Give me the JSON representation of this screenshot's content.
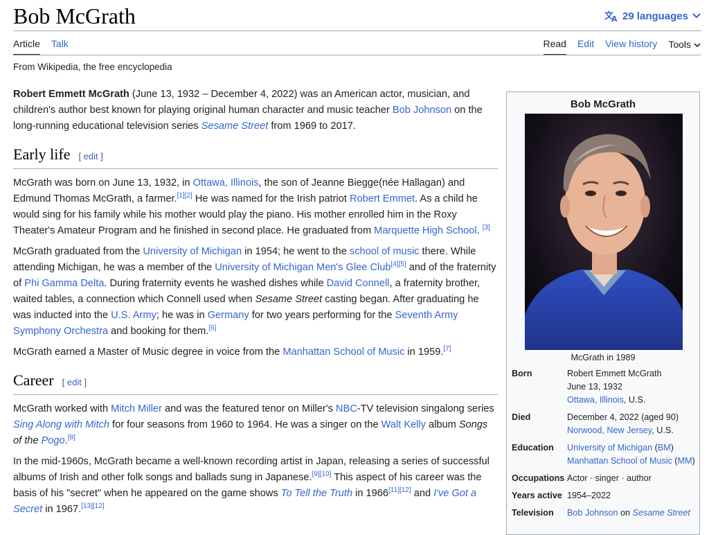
{
  "page": {
    "title": "Bob McGrath",
    "languages": "29 languages",
    "tabs_left": [
      "Article",
      "Talk"
    ],
    "tabs_right": [
      "Read",
      "Edit",
      "View history",
      "Tools"
    ],
    "tagline": "From Wikipedia, the free encyclopedia"
  },
  "intro": {
    "bold_name": "Robert Emmett McGrath",
    "t1": " (June 13, 1932 – December 4, 2022) was an American actor, musician, and children's author best known for playing original human character and music teacher ",
    "l1": "Bob Johnson",
    "t2": " on the long-running educational television series ",
    "l2": "Sesame Street",
    "t3": " from 1969 to 2017."
  },
  "sections": {
    "early_life": "Early life",
    "career": "Career",
    "edit_label": "edit"
  },
  "early": {
    "p1": {
      "t1": "McGrath was born on June 13, 1932, in ",
      "l1": "Ottawa, Illinois",
      "t2": ", the son of Jeanne Biegge(née Hallagan) and Edmund Thomas McGrath, a farmer.",
      "r1": "[1]",
      "r2": "[2]",
      "t3": " He was named for the Irish patriot ",
      "l2": "Robert Emmet",
      "t4": ". As a child he would sing for his family while his mother would play the piano. His mother enrolled him in the Roxy Theater's Amateur Program and he finished in second place. He graduated from ",
      "l3": "Marquette High School",
      "t5": ". ",
      "r3": "[3]"
    },
    "p2": {
      "t1": "McGrath graduated from the ",
      "l1": "University of Michigan",
      "t2": " in 1954; he went to the ",
      "l2": "school of music",
      "t3": " there. While attending Michigan, he was a member of the ",
      "l3": "University of Michigan Men's Glee Club",
      "r4": "[4]",
      "r5": "[5]",
      "t4": " and of the fraternity of ",
      "l4": "Phi Gamma Delta",
      "t5": ". During fraternity events he washed dishes while ",
      "l5": "David Connell",
      "t6": ", a fraternity brother, waited tables, a connection which Connell used when ",
      "i1": "Sesame Street",
      "t7": " casting began. After graduating he was inducted into the ",
      "l6": "U.S. Army",
      "t8": "; he was in ",
      "l7": "Germany",
      "t9": " for two years performing for the ",
      "l8": "Seventh Army Symphony Orchestra",
      "t10": " and booking for them.",
      "r6": "[6]"
    },
    "p3": {
      "t1": "McGrath earned a Master of Music degree in voice from the ",
      "l1": "Manhattan School of Music",
      "t2": " in 1959.",
      "r7": "[7]"
    }
  },
  "career": {
    "p1": {
      "t1": "McGrath worked with ",
      "l1": "Mitch Miller",
      "t2": " and was the featured tenor on Miller's ",
      "l2": "NBC",
      "t3": "-TV television singalong series ",
      "l3": "Sing Along with Mitch",
      "t4": " for four seasons from 1960 to 1964. He was a singer on the ",
      "l4": "Walt Kelly",
      "t5": " album ",
      "i1": "Songs of the ",
      "l5": "Pogo",
      "t6": ".",
      "r8": "[8]"
    },
    "p2": {
      "t1": "In the mid-1960s, McGrath became a well-known recording artist in Japan, releasing a series of successful albums of Irish and other folk songs and ballads sung in Japanese.",
      "r9": "[9]",
      "r10": "[10]",
      "t2": " This aspect of his career was the basis of his \"secret\" when he appeared on the game shows ",
      "l1": "To Tell the Truth",
      "t3": " in 1966",
      "r11": "[11]",
      "r12": "[12]",
      "t4": " and ",
      "l2": "I've Got a Secret",
      "t5": " in 1967.",
      "r13": "[13]",
      "r14": "[12]"
    }
  },
  "infobox": {
    "title": "Bob McGrath",
    "caption": "McGrath in 1989",
    "born_label": "Born",
    "born_name": "Robert Emmett McGrath",
    "born_date": "June 13, 1932",
    "born_place_link": "Ottawa, Illinois",
    "born_place_rest": ", U.S.",
    "died_label": "Died",
    "died_date": "December 4, 2022 (aged 90)",
    "died_place_link": "Norwood, New Jersey",
    "died_place_rest": ", U.S.",
    "education_label": "Education",
    "edu1_link": "University of Michigan",
    "edu1_abbr": "BM",
    "edu2_link": "Manhattan School of Music",
    "edu2_abbr": "MM",
    "occupations_label": "Occupations",
    "occupations": "Actor · singer · author",
    "years_label": "Years active",
    "years": "1954–2022",
    "television_label": "Television",
    "tv_link1": "Bob Johnson",
    "tv_mid": " on ",
    "tv_link2": "Sesame Street"
  },
  "icons": {
    "language": "translate-icon",
    "chevron": "chevron-down-icon"
  },
  "colors": {
    "link": "#3366cc",
    "text": "#202122",
    "border": "#a2a9b1",
    "infobox_bg": "#f8f9fa"
  }
}
